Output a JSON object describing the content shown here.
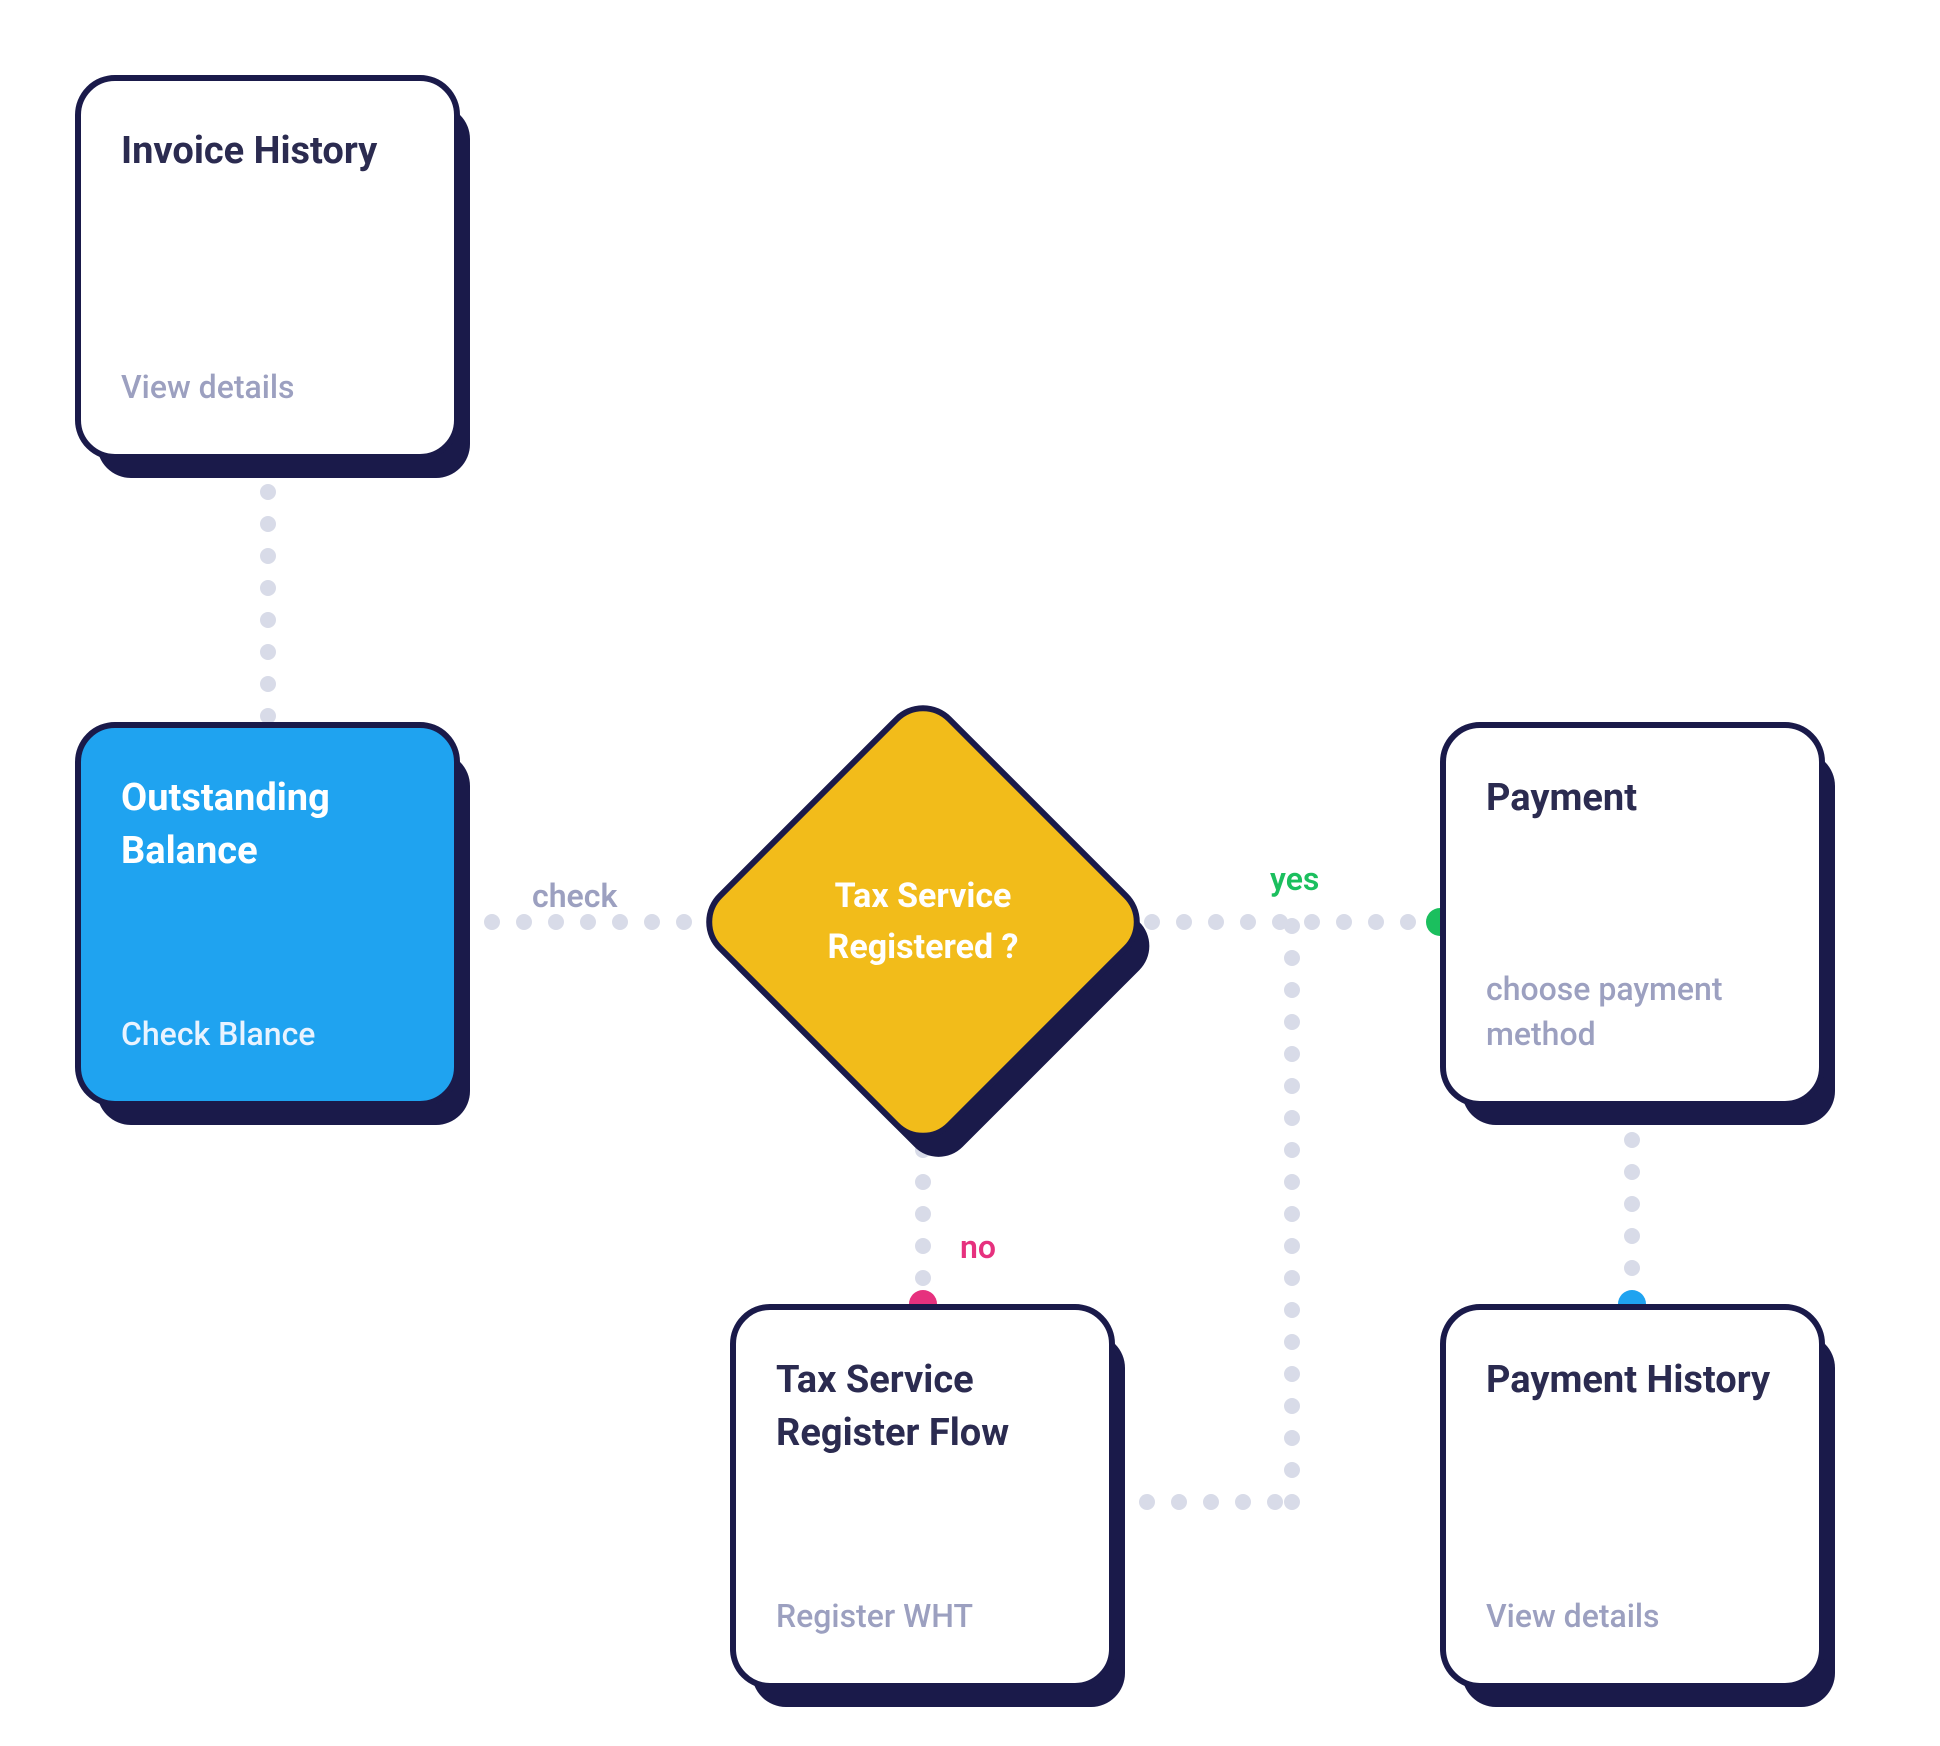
{
  "nodes": {
    "invoice_history": {
      "title": "Invoice History",
      "subtitle": "View details"
    },
    "outstanding_balance": {
      "title": "Outstanding Balance",
      "subtitle": "Check Blance"
    },
    "tax_decision": {
      "title": "Tax Service Registered ?"
    },
    "tax_register_flow": {
      "title": "Tax Service Register Flow",
      "subtitle": "Register WHT"
    },
    "payment": {
      "title": "Payment",
      "subtitle": "choose payment method"
    },
    "payment_history": {
      "title": "Payment History",
      "subtitle": "View details"
    }
  },
  "edges": {
    "check": "check",
    "yes": "yes",
    "no": "no"
  },
  "colors": {
    "node_border": "#1a1a4a",
    "card_bg": "#ffffff",
    "blue_card": "#1fa3f0",
    "diamond": "#f2bc1a",
    "dot_blue": "#1fa3f0",
    "dot_green": "#1bbf5e",
    "dot_pink": "#e6317e",
    "text_muted": "#9ca0c0"
  }
}
